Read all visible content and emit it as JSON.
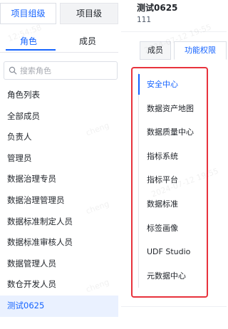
{
  "left": {
    "level_tabs": [
      "项目组级",
      "项目级"
    ],
    "sub_tabs": [
      "角色",
      "成员"
    ],
    "search": {
      "placeholder": "搜索角色",
      "value": ""
    },
    "roles": [
      {
        "label": "角色列表"
      },
      {
        "label": "全部成员"
      },
      {
        "label": "负责人"
      },
      {
        "label": "管理员"
      },
      {
        "label": "数据治理专员"
      },
      {
        "label": "数据治理管理员"
      },
      {
        "label": "数据标准制定人员"
      },
      {
        "label": "数据标准审核人员"
      },
      {
        "label": "数据管理人员"
      },
      {
        "label": "数仓开发人员"
      },
      {
        "label": "测试0625"
      }
    ],
    "selected_role": "测试0625"
  },
  "right": {
    "title": "测试0625",
    "subtitle": "111",
    "tabs": [
      "成员",
      "功能权限"
    ],
    "active_tab": "功能权限",
    "menu": [
      {
        "label": "安全中心"
      },
      {
        "label": "数据资产地图"
      },
      {
        "label": "数据质量中心"
      },
      {
        "label": "指标系统"
      },
      {
        "label": "指标平台"
      },
      {
        "label": "数据标准"
      },
      {
        "label": "标签画像"
      },
      {
        "label": "UDF Studio"
      },
      {
        "label": "元数据中心"
      }
    ],
    "active_menu": "安全中心"
  },
  "watermark": [
    "cheng",
    "12:54:58",
    "2024-07-12 19:55"
  ],
  "colors": {
    "accent": "#1664ff",
    "highlight_border": "#e8323c",
    "selected_bg": "#eaf1ff"
  }
}
